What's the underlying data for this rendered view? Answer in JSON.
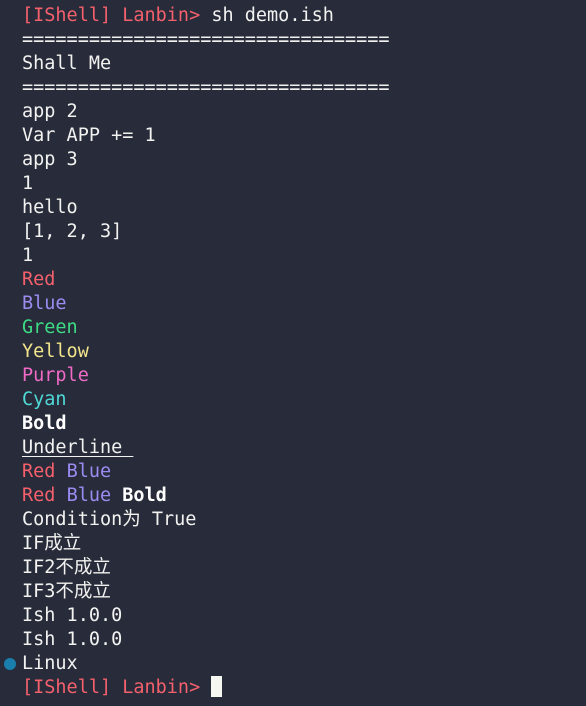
{
  "terminal": {
    "background_color": "#282c3a",
    "foreground_color": "#f2f2f0",
    "palette": {
      "red": "#f4606c",
      "blue": "#9b8cf2",
      "green": "#3ddc84",
      "yellow": "#f2e58c",
      "purple": "#f06ac6",
      "cyan": "#4fd9d6",
      "white": "#ffffff",
      "bullet_teal": "#1a7fad",
      "cursor": "#f7f7f2"
    },
    "prompt": {
      "bracket_name": "[IShell]",
      "user": "Lanbin>",
      "full": "[IShell] Lanbin>"
    },
    "command": "sh demo.ish",
    "separator": "=================================",
    "banner_title": "Shall Me",
    "output_lines": [
      "app 2",
      "Var APP += 1",
      "app 3",
      "1",
      "hello",
      "[1, 2, 3]",
      "1"
    ],
    "color_demo": [
      {
        "text": "Red",
        "color": "red"
      },
      {
        "text": "Blue",
        "color": "blue"
      },
      {
        "text": "Green",
        "color": "green"
      },
      {
        "text": "Yellow",
        "color": "yellow"
      },
      {
        "text": "Purple",
        "color": "purple"
      },
      {
        "text": "Cyan",
        "color": "cyan"
      }
    ],
    "style_demo": {
      "bold": "Bold",
      "underline": "Underline "
    },
    "combo_line_1": {
      "part_red": "Red",
      "space": " ",
      "part_blue": "Blue"
    },
    "combo_line_2": {
      "part_red": "Red",
      "space_a": " ",
      "part_blue": "Blue",
      "space_b": " ",
      "part_bold": "Bold"
    },
    "condition_line": "Condition为 True",
    "if_lines": [
      "IF成立",
      "IF2不成立",
      "IF3不成立"
    ],
    "version_lines": [
      "Ish 1.0.0",
      "Ish 1.0.0"
    ],
    "platform_line": "Linux",
    "final_prompt": "[IShell] Lanbin>"
  }
}
